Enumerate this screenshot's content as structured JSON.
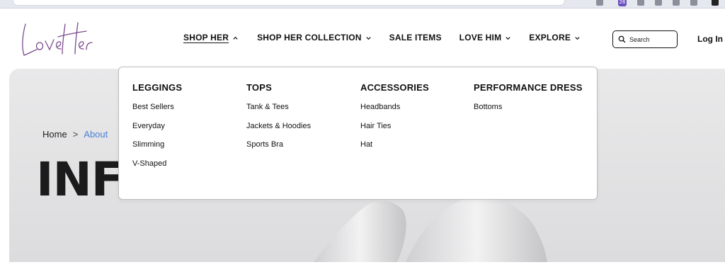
{
  "brand": {
    "logo_text": "LoveHer",
    "logo_color": "#7a4b8c"
  },
  "nav": {
    "items": [
      {
        "label": "SHOP HER",
        "chevron": "up"
      },
      {
        "label": "SHOP HER COLLECTION",
        "chevron": "down"
      },
      {
        "label": "SALE ITEMS",
        "chevron": "none"
      },
      {
        "label": "LOVE HIM",
        "chevron": "down"
      },
      {
        "label": "EXPLORE",
        "chevron": "down"
      }
    ]
  },
  "search": {
    "placeholder": "Search",
    "icon": "search-icon"
  },
  "account": {
    "login_label": "Log In"
  },
  "dropdown": {
    "columns": [
      {
        "title": "LEGGINGS",
        "links": [
          "Best Sellers",
          "Everyday",
          "Slimming",
          "V-Shaped"
        ]
      },
      {
        "title": "TOPS",
        "links": [
          "Tank & Tees",
          "Jackets & Hoodies",
          "Sports Bra"
        ]
      },
      {
        "title": "ACCESSORIES",
        "links": [
          "Headbands",
          "Hair Ties",
          "Hat"
        ]
      },
      {
        "title": "PERFORMANCE DRESS",
        "links": [
          "Bottoms"
        ]
      }
    ]
  },
  "breadcrumb": {
    "home": "Home",
    "separator": ">",
    "current": "About"
  },
  "hero": {
    "title_visible": "INFO"
  },
  "colors": {
    "link": "#4a7fd6",
    "text": "#111111"
  }
}
